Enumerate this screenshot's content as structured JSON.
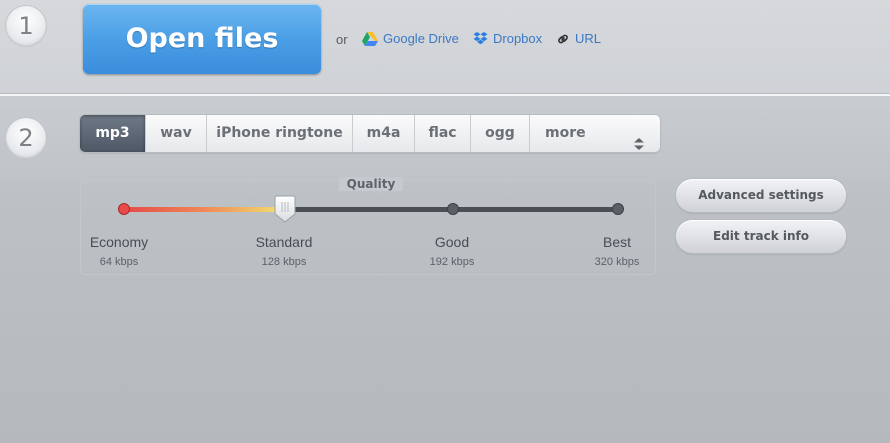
{
  "step1": {
    "number": "1",
    "open_button": "Open files",
    "or": "or",
    "sources": [
      {
        "label": "Google Drive",
        "icon": "google-drive-icon"
      },
      {
        "label": "Dropbox",
        "icon": "dropbox-icon"
      },
      {
        "label": "URL",
        "icon": "link-icon"
      }
    ]
  },
  "step2": {
    "number": "2",
    "formats": [
      "mp3",
      "wav",
      "iPhone ringtone",
      "m4a",
      "flac",
      "ogg",
      "more"
    ],
    "active_format": "mp3",
    "quality": {
      "title": "Quality",
      "selected_index": 1,
      "levels": [
        {
          "label": "Economy",
          "rate": "64 kbps"
        },
        {
          "label": "Standard",
          "rate": "128 kbps"
        },
        {
          "label": "Good",
          "rate": "192 kbps"
        },
        {
          "label": "Best",
          "rate": "320 kbps"
        }
      ]
    },
    "buttons": {
      "advanced": "Advanced settings",
      "edit_track": "Edit track info"
    }
  },
  "colors": {
    "accent_blue": "#4b9fe6",
    "link_blue": "#3b79c4",
    "active_tab": "#5b6572"
  }
}
